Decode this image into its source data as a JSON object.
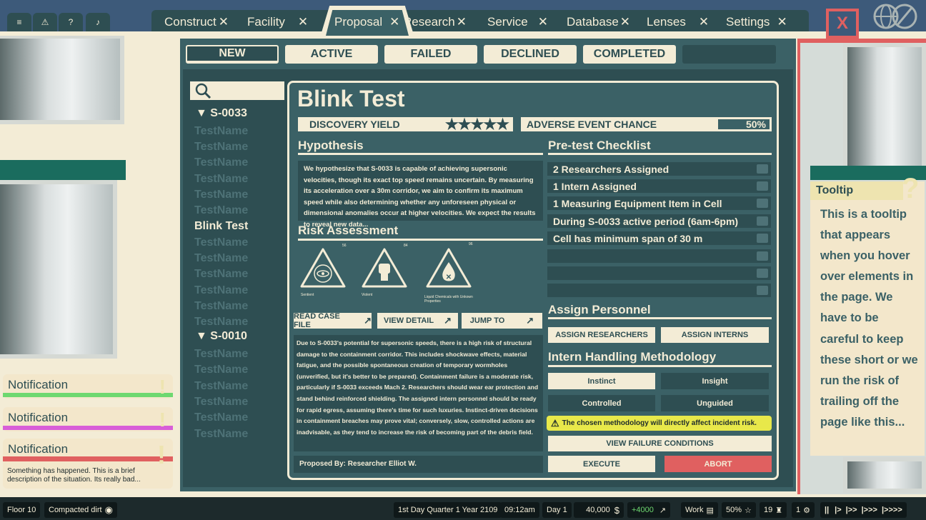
{
  "top_icons": [
    "menu-icon",
    "warning-icon",
    "help-icon",
    "bell-icon"
  ],
  "tabs": [
    {
      "label": "Construct"
    },
    {
      "label": "Facility"
    },
    {
      "label": "Proposal"
    },
    {
      "label": "Research"
    },
    {
      "label": "Service"
    },
    {
      "label": "Database"
    },
    {
      "label": "Lenses"
    },
    {
      "label": "Settings"
    }
  ],
  "close_label": "X",
  "proposal_tabs": [
    "NEW",
    "ACTIVE",
    "FAILED",
    "DECLINED",
    "COMPLETED"
  ],
  "sidebar": {
    "groups": [
      {
        "label": "S-0033",
        "items": [
          "TestName",
          "TestName",
          "TestName",
          "TestName",
          "TestName",
          "TestName",
          "Blink Test",
          "TestName",
          "TestName",
          "TestName",
          "TestName",
          "TestName",
          "TestName"
        ]
      },
      {
        "label": "S-0010",
        "items": [
          "TestName",
          "TestName",
          "TestName",
          "TestName",
          "TestName",
          "TestName"
        ]
      }
    ],
    "selected": "Blink Test"
  },
  "proposal": {
    "title": "Blink Test",
    "discovery_label": "DISCOVERY YIELD",
    "discovery_stars": "★★★★★",
    "adverse_label": "ADVERSE EVENT CHANCE",
    "adverse_value": "50%",
    "adverse_level": 0.5,
    "hypothesis_head": "Hypothesis",
    "hypothesis_text": "We hypothesize that S-0033 is capable of achieving supersonic velocities, though its exact top speed remains uncertain. By measuring its acceleration over a 30m corridor, we aim to confirm its maximum speed while also determining whether any unforeseen physical or dimensional anomalies occur at higher velocities. We expect the results to reveal new data...",
    "risk_head": "Risk Assessment",
    "risks": [
      {
        "label": "Sentient",
        "value": "56",
        "icon": "eye-icon"
      },
      {
        "label": "Violent",
        "value": "84",
        "icon": "fist-icon"
      },
      {
        "label": "Liquid Chemicals with Unkown Properties",
        "value": "96",
        "icon": "chemical-icon"
      }
    ],
    "read_case": "READ CASE FILE",
    "view_detail": "VIEW DETAIL",
    "jump_to": "JUMP TO",
    "risk_text": "Due to S-0033's potential for supersonic speeds, there is a high risk of structural damage to the containment corridor. This includes shockwave effects, material fatigue, and the possible spontaneous creation of temporary wormholes (unverified, but it's better to be prepared). Containment failure is a moderate risk, particularly if S-0033 exceeds Mach 2. Researchers should wear ear protection and stand behind reinforced shielding. The assigned intern personnel should be ready for rapid egress, assuming there's time for such luxuries. Instinct-driven decisions in containment breaches may prove vital; conversely, slow, controlled actions are inadvisable, as they tend to increase the risk of becoming part of the debris field.",
    "proposed_by": "Proposed By: Researcher Elliot W.",
    "checklist_head": "Pre-test  Checklist",
    "checklist": [
      "2 Researchers Assigned",
      "1 Intern Assigned",
      "1 Measuring Equipment Item in Cell",
      "During S-0033 active period (6am-6pm)",
      "Cell has minimum span of 30 m",
      "",
      "",
      ""
    ],
    "assign_head": "Assign Personnel",
    "assign_researchers": "ASSIGN RESEARCHERS",
    "assign_interns": "ASSIGN INTERNS",
    "method_head": "Intern Handling Methodology",
    "methods": [
      "Instinct",
      "Insight",
      "Controlled",
      "Unguided"
    ],
    "warning": "The chosen methodology will directly affect incident risk.",
    "view_failure": "VIEW FAILURE CONDITIONS",
    "execute": "EXECUTE",
    "abort": "ABORT"
  },
  "tooltip": {
    "title": "Tooltip",
    "body": "This is a tooltip that appears when you hover over elements in the page. We have to be careful to keep these short or we run the risk of trailing off the page like this..."
  },
  "notifications": [
    {
      "title": "Notification",
      "color": "#6ed870"
    },
    {
      "title": "Notification",
      "color": "#d85ed8"
    },
    {
      "title": "Notification",
      "color": "#e06060",
      "text": "Something has happened.  This is a brief description of the situation. Its really bad..."
    }
  ],
  "bottom": {
    "floor": "Floor 10",
    "terrain": "Compacted dirt",
    "date": "1st Day Quarter 1 Year 2109",
    "time": "09:12am",
    "day": "Day 1",
    "money": "40,000",
    "income": "+4000",
    "mode": "Work",
    "percent": "50%",
    "count_a": "19",
    "count_b": "1",
    "speed": [
      "||",
      "|>",
      "|>>",
      "|>>>",
      "|>>>>"
    ]
  },
  "colors": {
    "dark": "#2e4e52",
    "panel": "#3b6166",
    "cream": "#f3ecd6",
    "red": "#e06060",
    "warn": "#e8e84a"
  }
}
